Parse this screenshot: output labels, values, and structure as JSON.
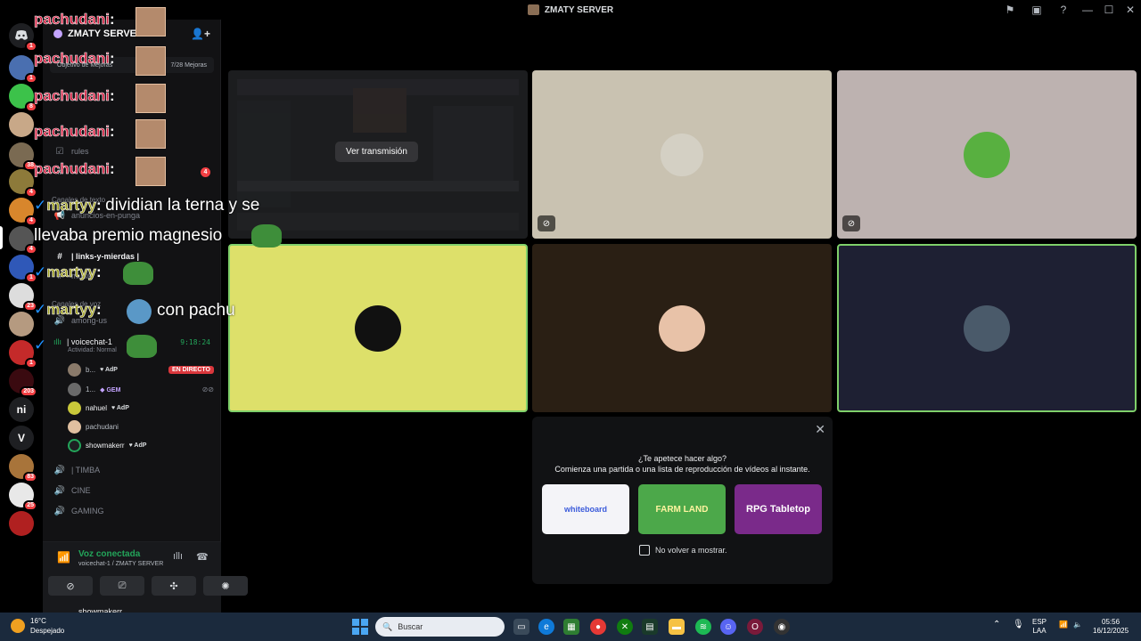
{
  "window": {
    "title": "ZMATY SERVER"
  },
  "server": {
    "name": "ZMATY SERVER",
    "boost_label": "Objetivo de Mejoras",
    "boost_count": "7/28 Mejoras"
  },
  "channels": {
    "rules": "rules",
    "unread_badge": "4",
    "text_category": "Canales de texto",
    "anuncios": "anuncios-en-punga",
    "links": "| links-y-mierdas |",
    "musik": "musik",
    "voice_category": "Canales de voz",
    "among": "among-us",
    "voicechat": "| voicechat-1",
    "voicechat_time": "9:18:24",
    "voicechat_status": "Actividad: Normal",
    "timba": "| TIMBA",
    "cine": "CINE",
    "gaming": "GAMING"
  },
  "voice_users": [
    {
      "name": "b...",
      "tag": "AdP",
      "live": "EN DIRECTO"
    },
    {
      "name": "1...",
      "tag": "GEM",
      "live": ""
    },
    {
      "name": "nahuel",
      "tag": "AdP",
      "live": ""
    },
    {
      "name": "pachudani",
      "tag": "",
      "live": ""
    },
    {
      "name": "showmakerr",
      "tag": "AdP",
      "live": ""
    }
  ],
  "voice_panel": {
    "status": "Voz conectada",
    "location": "voicechat-1 / ZMATY SERVER",
    "username": "showmakerr"
  },
  "rail_badges": [
    "1",
    "1",
    "8",
    "38",
    "4",
    "4",
    "4",
    "1",
    "23",
    "1",
    "203",
    "83",
    "25"
  ],
  "rail_text": {
    "ni": "ni",
    "v": "V"
  },
  "stream": {
    "view_button": "Ver transmisión"
  },
  "activity": {
    "title": "¿Te apetece hacer algo?",
    "subtitle": "Comienza una partida o una lista de reproducción de vídeos al instante.",
    "card1": "whiteboard",
    "card2": "FARM LAND",
    "card3": "RPG Tabletop",
    "checkbox_label": "No volver a mostrar."
  },
  "overlay": {
    "pachu_name": "pachudani",
    "colon": ":",
    "marty_name": "martyy",
    "msg1_line1": "dividian la terna y se",
    "msg1_line2": "llevaba premio magnesio",
    "msg3": "con pachu"
  },
  "taskbar": {
    "temperature": "16°C",
    "weather": "Despejado",
    "search_placeholder": "Buscar",
    "lang": "ESP",
    "layout": "LAA",
    "time": "05:56",
    "date": "16/12/2025"
  },
  "colors": {
    "online_green": "#23a55a",
    "live_red": "#da373c",
    "badge_red": "#f23f43",
    "tile_yellow": "#dde06a",
    "tile_beige": "#c9c2b1",
    "tile_brown": "#2a1f14",
    "tile_navy": "#1e2033"
  }
}
